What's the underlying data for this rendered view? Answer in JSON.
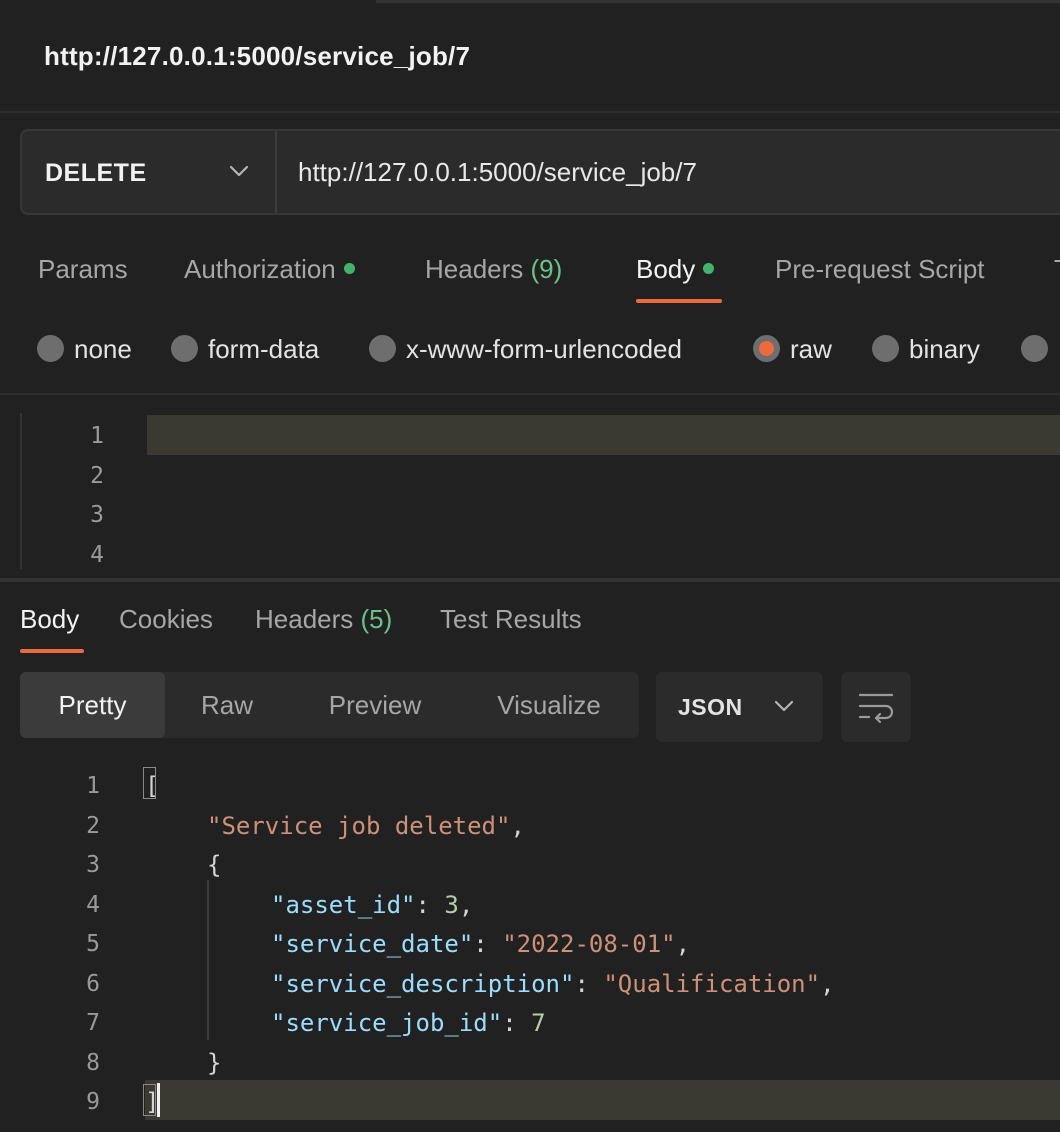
{
  "request": {
    "title": "http://127.0.0.1:5000/service_job/7",
    "method": "DELETE",
    "url": "http://127.0.0.1:5000/service_job/7"
  },
  "request_tabs": {
    "params": "Params",
    "authorization": "Authorization",
    "headers": "Headers",
    "headers_count": "(9)",
    "body": "Body",
    "pre_request_script": "Pre-request Script",
    "truncated": "T"
  },
  "body_types": {
    "none": "none",
    "form_data": "form-data",
    "urlencoded": "x-www-form-urlencoded",
    "raw": "raw",
    "binary": "binary",
    "selected": "raw"
  },
  "request_editor": {
    "line_numbers": [
      "1",
      "2",
      "3",
      "4"
    ]
  },
  "response_tabs": {
    "body": "Body",
    "cookies": "Cookies",
    "headers": "Headers",
    "headers_count": "(5)",
    "test_results": "Test Results"
  },
  "response_view": {
    "modes": [
      "Pretty",
      "Raw",
      "Preview",
      "Visualize"
    ],
    "active_mode": "Pretty",
    "format": "JSON"
  },
  "response_body": {
    "line_numbers": [
      "1",
      "2",
      "3",
      "4",
      "5",
      "6",
      "7",
      "8",
      "9"
    ],
    "open_bracket": "[",
    "message": "\"Service job deleted\"",
    "open_brace": "{",
    "fields": [
      {
        "key": "\"asset_id\"",
        "value": "3",
        "type": "number",
        "trail": ","
      },
      {
        "key": "\"service_date\"",
        "value": "\"2022-08-01\"",
        "type": "string",
        "trail": ","
      },
      {
        "key": "\"service_description\"",
        "value": "\"Qualification\"",
        "type": "string",
        "trail": ","
      },
      {
        "key": "\"service_job_id\"",
        "value": "7",
        "type": "number",
        "trail": ""
      }
    ],
    "close_brace": "}",
    "close_bracket": "]"
  },
  "colors": {
    "accent": "#ec6a3e",
    "status_dot": "#45b26b",
    "count_green": "#6bc287",
    "json_key": "#9cdcfe",
    "json_string": "#ce9178",
    "json_number": "#b5cea8"
  }
}
